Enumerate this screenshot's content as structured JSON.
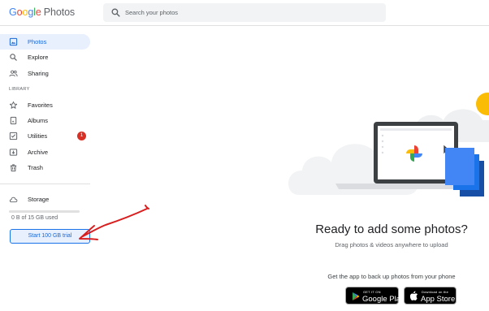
{
  "app": {
    "logo_letters": [
      "G",
      "o",
      "o",
      "g",
      "l",
      "e"
    ],
    "logo_word": "Photos"
  },
  "search": {
    "placeholder": "Search your photos",
    "icon": "search-icon"
  },
  "sidebar": {
    "items": [
      {
        "label": "Photos",
        "icon": "photo-icon",
        "active": true
      },
      {
        "label": "Explore",
        "icon": "search-icon"
      },
      {
        "label": "Sharing",
        "icon": "people-icon"
      }
    ],
    "library_label": "LIBRARY",
    "library_items": [
      {
        "label": "Favorites",
        "icon": "star-icon"
      },
      {
        "label": "Albums",
        "icon": "album-icon"
      },
      {
        "label": "Utilities",
        "icon": "utilities-icon",
        "badge": "1"
      },
      {
        "label": "Archive",
        "icon": "archive-icon"
      },
      {
        "label": "Trash",
        "icon": "trash-icon"
      }
    ],
    "storage": {
      "label": "Storage",
      "icon": "cloud-icon",
      "used_text": "0 B of 15 GB used",
      "used_fraction": 0.0
    },
    "trial_button": "Start 100 GB trial"
  },
  "main": {
    "title": "Ready to add some photos?",
    "subtitle": "Drag photos & videos anywhere to upload",
    "app_prompt": "Get the app to back up photos from your phone",
    "google_play": {
      "small": "GET IT ON",
      "big": "Google Play"
    },
    "app_store": {
      "small": "Download on the",
      "big": "App Store"
    }
  },
  "colors": {
    "accent": "#1a73e8",
    "active_bg": "#e8f0fe",
    "badge": "#d93025",
    "annotation_arrow": "#d81e1e"
  }
}
